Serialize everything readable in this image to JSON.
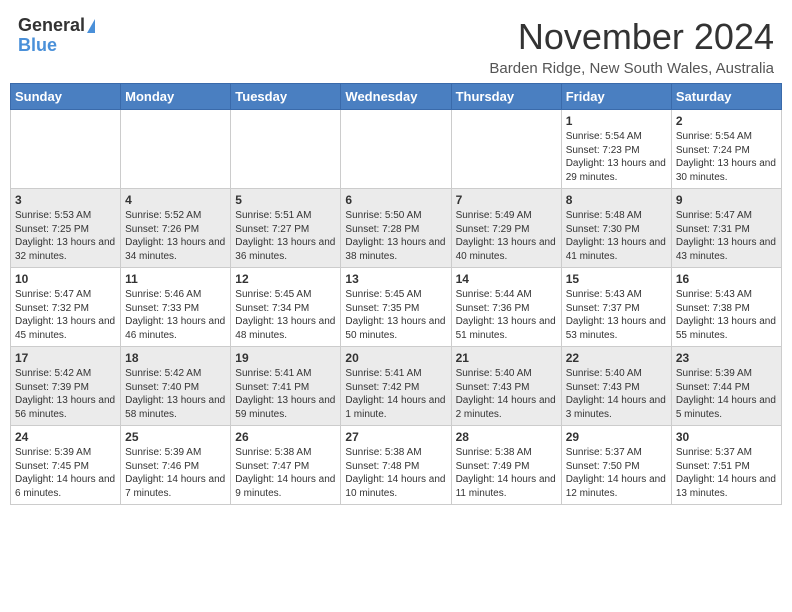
{
  "header": {
    "logo_general": "General",
    "logo_blue": "Blue",
    "month_title": "November 2024",
    "location": "Barden Ridge, New South Wales, Australia"
  },
  "days_of_week": [
    "Sunday",
    "Monday",
    "Tuesday",
    "Wednesday",
    "Thursday",
    "Friday",
    "Saturday"
  ],
  "weeks": [
    [
      {
        "day": "",
        "info": ""
      },
      {
        "day": "",
        "info": ""
      },
      {
        "day": "",
        "info": ""
      },
      {
        "day": "",
        "info": ""
      },
      {
        "day": "",
        "info": ""
      },
      {
        "day": "1",
        "info": "Sunrise: 5:54 AM\nSunset: 7:23 PM\nDaylight: 13 hours and 29 minutes."
      },
      {
        "day": "2",
        "info": "Sunrise: 5:54 AM\nSunset: 7:24 PM\nDaylight: 13 hours and 30 minutes."
      }
    ],
    [
      {
        "day": "3",
        "info": "Sunrise: 5:53 AM\nSunset: 7:25 PM\nDaylight: 13 hours and 32 minutes."
      },
      {
        "day": "4",
        "info": "Sunrise: 5:52 AM\nSunset: 7:26 PM\nDaylight: 13 hours and 34 minutes."
      },
      {
        "day": "5",
        "info": "Sunrise: 5:51 AM\nSunset: 7:27 PM\nDaylight: 13 hours and 36 minutes."
      },
      {
        "day": "6",
        "info": "Sunrise: 5:50 AM\nSunset: 7:28 PM\nDaylight: 13 hours and 38 minutes."
      },
      {
        "day": "7",
        "info": "Sunrise: 5:49 AM\nSunset: 7:29 PM\nDaylight: 13 hours and 40 minutes."
      },
      {
        "day": "8",
        "info": "Sunrise: 5:48 AM\nSunset: 7:30 PM\nDaylight: 13 hours and 41 minutes."
      },
      {
        "day": "9",
        "info": "Sunrise: 5:47 AM\nSunset: 7:31 PM\nDaylight: 13 hours and 43 minutes."
      }
    ],
    [
      {
        "day": "10",
        "info": "Sunrise: 5:47 AM\nSunset: 7:32 PM\nDaylight: 13 hours and 45 minutes."
      },
      {
        "day": "11",
        "info": "Sunrise: 5:46 AM\nSunset: 7:33 PM\nDaylight: 13 hours and 46 minutes."
      },
      {
        "day": "12",
        "info": "Sunrise: 5:45 AM\nSunset: 7:34 PM\nDaylight: 13 hours and 48 minutes."
      },
      {
        "day": "13",
        "info": "Sunrise: 5:45 AM\nSunset: 7:35 PM\nDaylight: 13 hours and 50 minutes."
      },
      {
        "day": "14",
        "info": "Sunrise: 5:44 AM\nSunset: 7:36 PM\nDaylight: 13 hours and 51 minutes."
      },
      {
        "day": "15",
        "info": "Sunrise: 5:43 AM\nSunset: 7:37 PM\nDaylight: 13 hours and 53 minutes."
      },
      {
        "day": "16",
        "info": "Sunrise: 5:43 AM\nSunset: 7:38 PM\nDaylight: 13 hours and 55 minutes."
      }
    ],
    [
      {
        "day": "17",
        "info": "Sunrise: 5:42 AM\nSunset: 7:39 PM\nDaylight: 13 hours and 56 minutes."
      },
      {
        "day": "18",
        "info": "Sunrise: 5:42 AM\nSunset: 7:40 PM\nDaylight: 13 hours and 58 minutes."
      },
      {
        "day": "19",
        "info": "Sunrise: 5:41 AM\nSunset: 7:41 PM\nDaylight: 13 hours and 59 minutes."
      },
      {
        "day": "20",
        "info": "Sunrise: 5:41 AM\nSunset: 7:42 PM\nDaylight: 14 hours and 1 minute."
      },
      {
        "day": "21",
        "info": "Sunrise: 5:40 AM\nSunset: 7:43 PM\nDaylight: 14 hours and 2 minutes."
      },
      {
        "day": "22",
        "info": "Sunrise: 5:40 AM\nSunset: 7:43 PM\nDaylight: 14 hours and 3 minutes."
      },
      {
        "day": "23",
        "info": "Sunrise: 5:39 AM\nSunset: 7:44 PM\nDaylight: 14 hours and 5 minutes."
      }
    ],
    [
      {
        "day": "24",
        "info": "Sunrise: 5:39 AM\nSunset: 7:45 PM\nDaylight: 14 hours and 6 minutes."
      },
      {
        "day": "25",
        "info": "Sunrise: 5:39 AM\nSunset: 7:46 PM\nDaylight: 14 hours and 7 minutes."
      },
      {
        "day": "26",
        "info": "Sunrise: 5:38 AM\nSunset: 7:47 PM\nDaylight: 14 hours and 9 minutes."
      },
      {
        "day": "27",
        "info": "Sunrise: 5:38 AM\nSunset: 7:48 PM\nDaylight: 14 hours and 10 minutes."
      },
      {
        "day": "28",
        "info": "Sunrise: 5:38 AM\nSunset: 7:49 PM\nDaylight: 14 hours and 11 minutes."
      },
      {
        "day": "29",
        "info": "Sunrise: 5:37 AM\nSunset: 7:50 PM\nDaylight: 14 hours and 12 minutes."
      },
      {
        "day": "30",
        "info": "Sunrise: 5:37 AM\nSunset: 7:51 PM\nDaylight: 14 hours and 13 minutes."
      }
    ]
  ]
}
